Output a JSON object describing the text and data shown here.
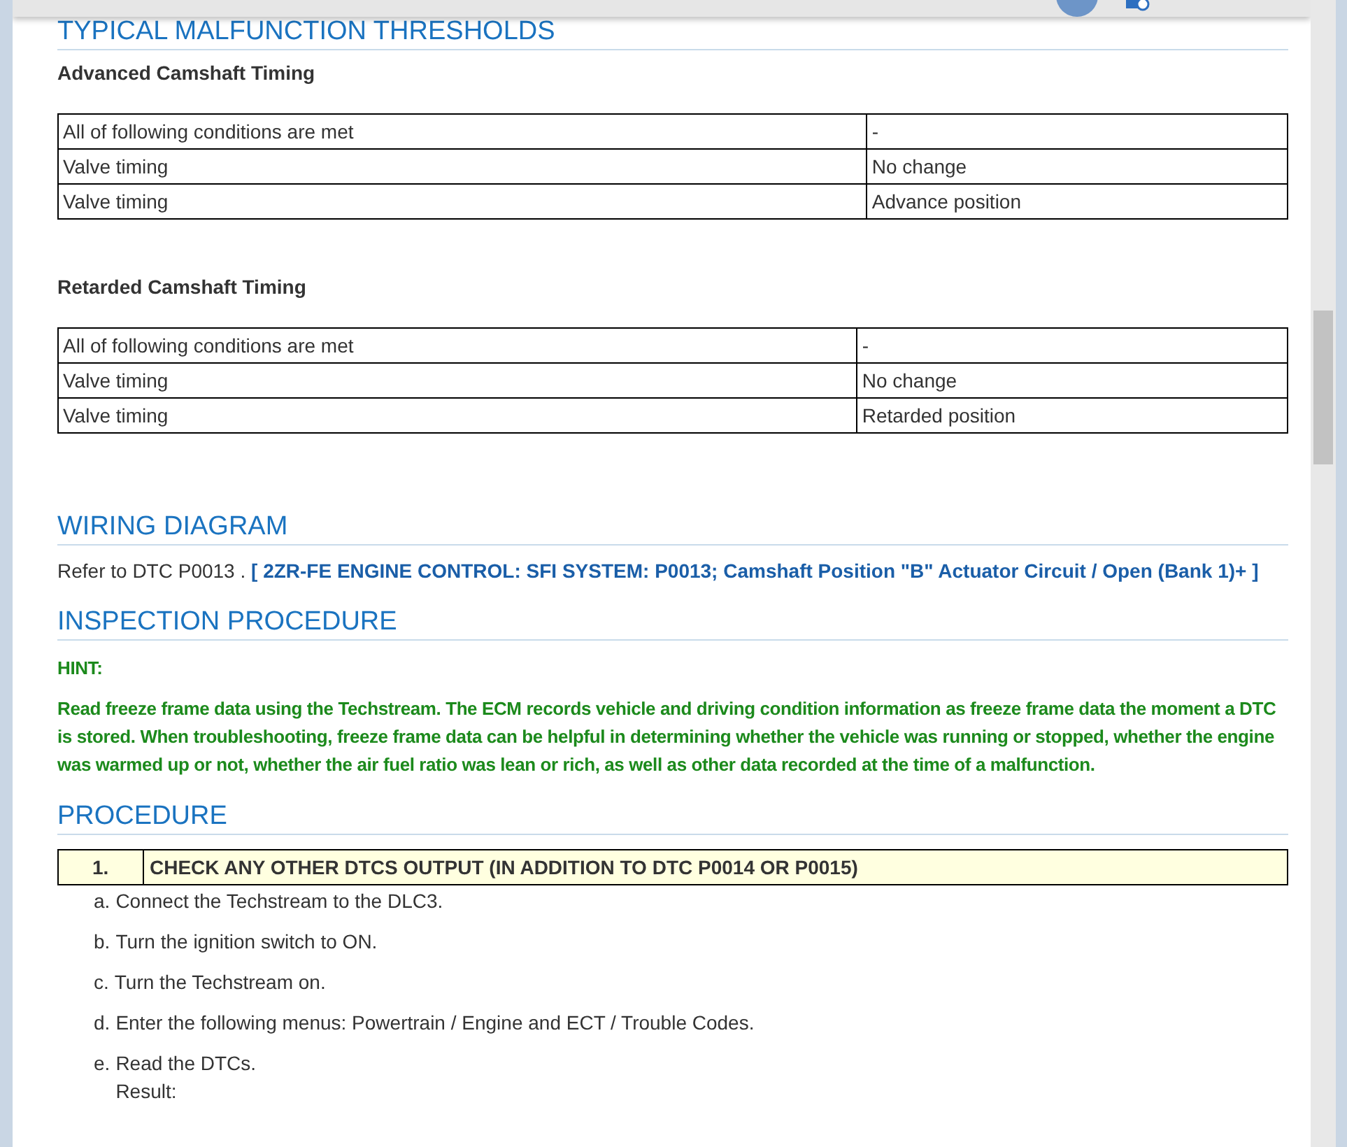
{
  "sections": [
    {
      "kind": "thresholds",
      "heading": "TYPICAL MALFUNCTION THRESHOLDS",
      "tables": [
        {
          "title": "Advanced Camshaft Timing",
          "rows": [
            [
              "All of following conditions are met",
              "-"
            ],
            [
              "Valve timing",
              "No change"
            ],
            [
              "Valve timing",
              "Advance position"
            ]
          ]
        },
        {
          "title": "Retarded Camshaft Timing",
          "rows": [
            [
              "All of following conditions are met",
              "-"
            ],
            [
              "Valve timing",
              "No change"
            ],
            [
              "Valve timing",
              "Retarded position"
            ]
          ]
        }
      ]
    },
    {
      "kind": "reference",
      "heading": "WIRING DIAGRAM",
      "text": "Refer to DTC P0013 .",
      "link": "[ 2ZR-FE ENGINE CONTROL: SFI SYSTEM: P0013; Camshaft Position \"B\" Actuator Circuit / Open (Bank 1)+ ]"
    },
    {
      "kind": "hint",
      "heading": "INSPECTION PROCEDURE",
      "label": "HINT:",
      "text": "Read freeze frame data using the Techstream. The ECM records vehicle and driving condition information as freeze frame data the moment a DTC is stored. When troubleshooting, freeze frame data can be helpful in determining whether the vehicle was running or stopped, whether the engine was warmed up or not, whether the air fuel ratio was lean or rich, as well as other data recorded at the time of a malfunction."
    },
    {
      "kind": "procedure",
      "heading": "PROCEDURE",
      "step_number": "1.",
      "step_title": "CHECK ANY OTHER DTCS OUTPUT (IN ADDITION TO DTC P0014 OR P0015)",
      "items": [
        {
          "letter": "a.",
          "text": "Connect the Techstream to the DLC3."
        },
        {
          "letter": "b.",
          "text": "Turn the ignition switch to ON."
        },
        {
          "letter": "c.",
          "text": "Turn the Techstream on."
        },
        {
          "letter": "d.",
          "text": "Enter the following menus: Powertrain / Engine and ECT / Trouble Codes."
        },
        {
          "letter": "e.",
          "text": "Read the DTCs.",
          "note": "Result:"
        }
      ]
    }
  ]
}
